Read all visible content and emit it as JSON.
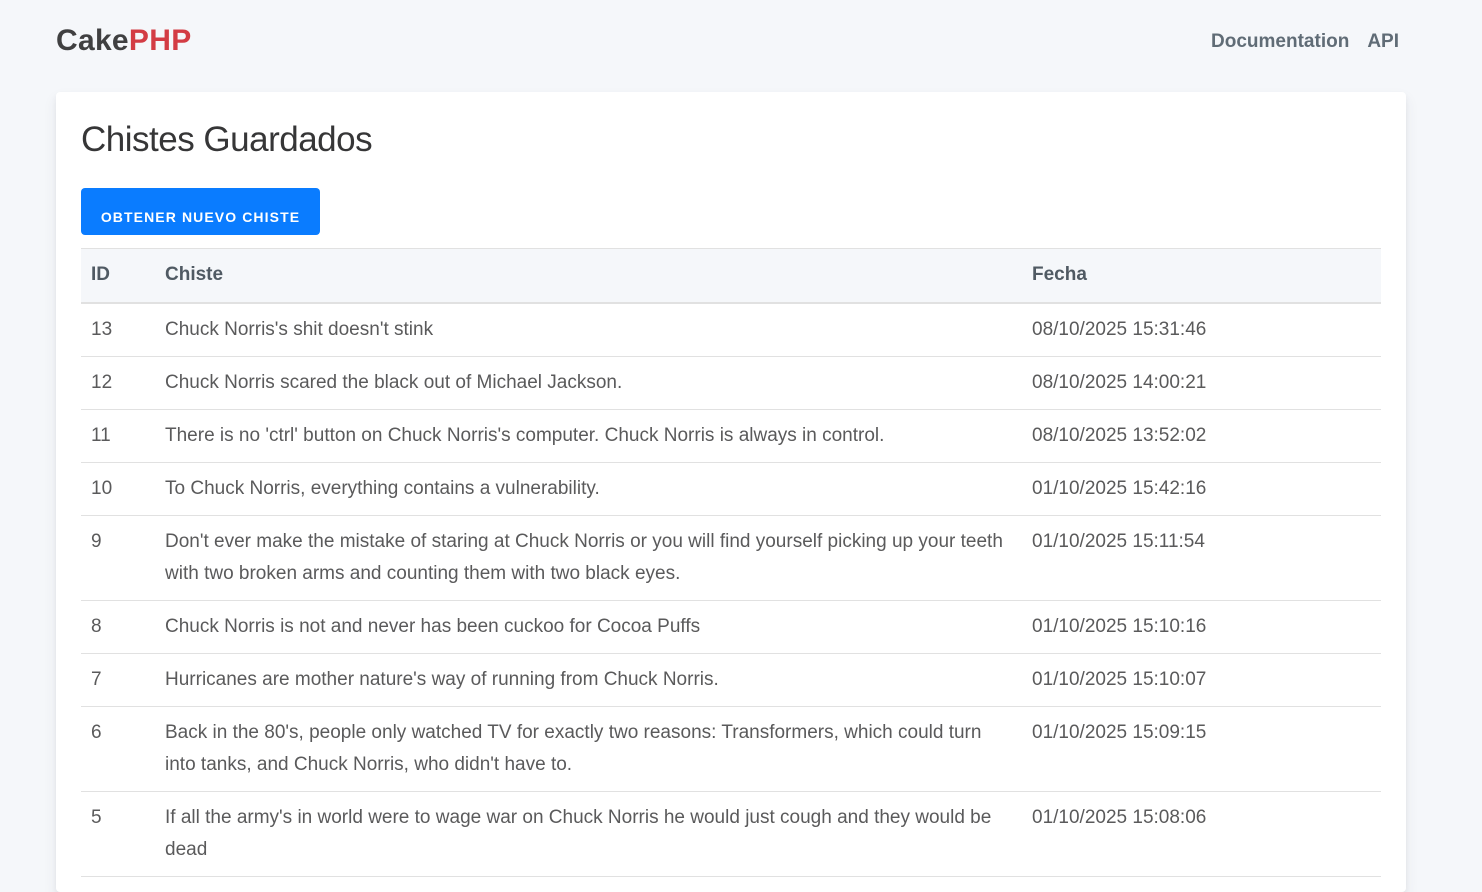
{
  "nav": {
    "brand_part1": "Cake",
    "brand_part2": "PHP",
    "links": [
      "Documentation",
      "API"
    ]
  },
  "main": {
    "title": "Chistes Guardados",
    "new_button_label": "OBTENER NUEVO CHISTE",
    "table": {
      "headers": [
        "ID",
        "Chiste",
        "Fecha"
      ],
      "rows": [
        {
          "id": "13",
          "joke": "Chuck Norris's shit doesn't stink",
          "date": "08/10/2025 15:31:46"
        },
        {
          "id": "12",
          "joke": "Chuck Norris scared the black out of Michael Jackson.",
          "date": "08/10/2025 14:00:21"
        },
        {
          "id": "11",
          "joke": "There is no 'ctrl' button on Chuck Norris's computer. Chuck Norris is always in control.",
          "date": "08/10/2025 13:52:02"
        },
        {
          "id": "10",
          "joke": "To Chuck Norris, everything contains a vulnerability.",
          "date": "01/10/2025 15:42:16"
        },
        {
          "id": "9",
          "joke": "Don't ever make the mistake of staring at Chuck Norris or you will find yourself picking up your teeth with two broken arms and counting them with two black eyes.",
          "date": "01/10/2025 15:11:54"
        },
        {
          "id": "8",
          "joke": "Chuck Norris is not and never has been cuckoo for Cocoa Puffs",
          "date": "01/10/2025 15:10:16"
        },
        {
          "id": "7",
          "joke": "Hurricanes are mother nature's way of running from Chuck Norris.",
          "date": "01/10/2025 15:10:07"
        },
        {
          "id": "6",
          "joke": "Back in the 80's, people only watched TV for exactly two reasons: Transformers, which could turn into tanks, and Chuck Norris, who didn't have to.",
          "date": "01/10/2025 15:09:15"
        },
        {
          "id": "5",
          "joke": "If all the army's in world were to wage war on Chuck Norris he would just cough and they would be dead",
          "date": "01/10/2025 15:08:06"
        }
      ]
    }
  },
  "colors": {
    "brand_red": "#d33c44",
    "primary_button": "#0a7cff",
    "background": "#f5f7fa"
  }
}
